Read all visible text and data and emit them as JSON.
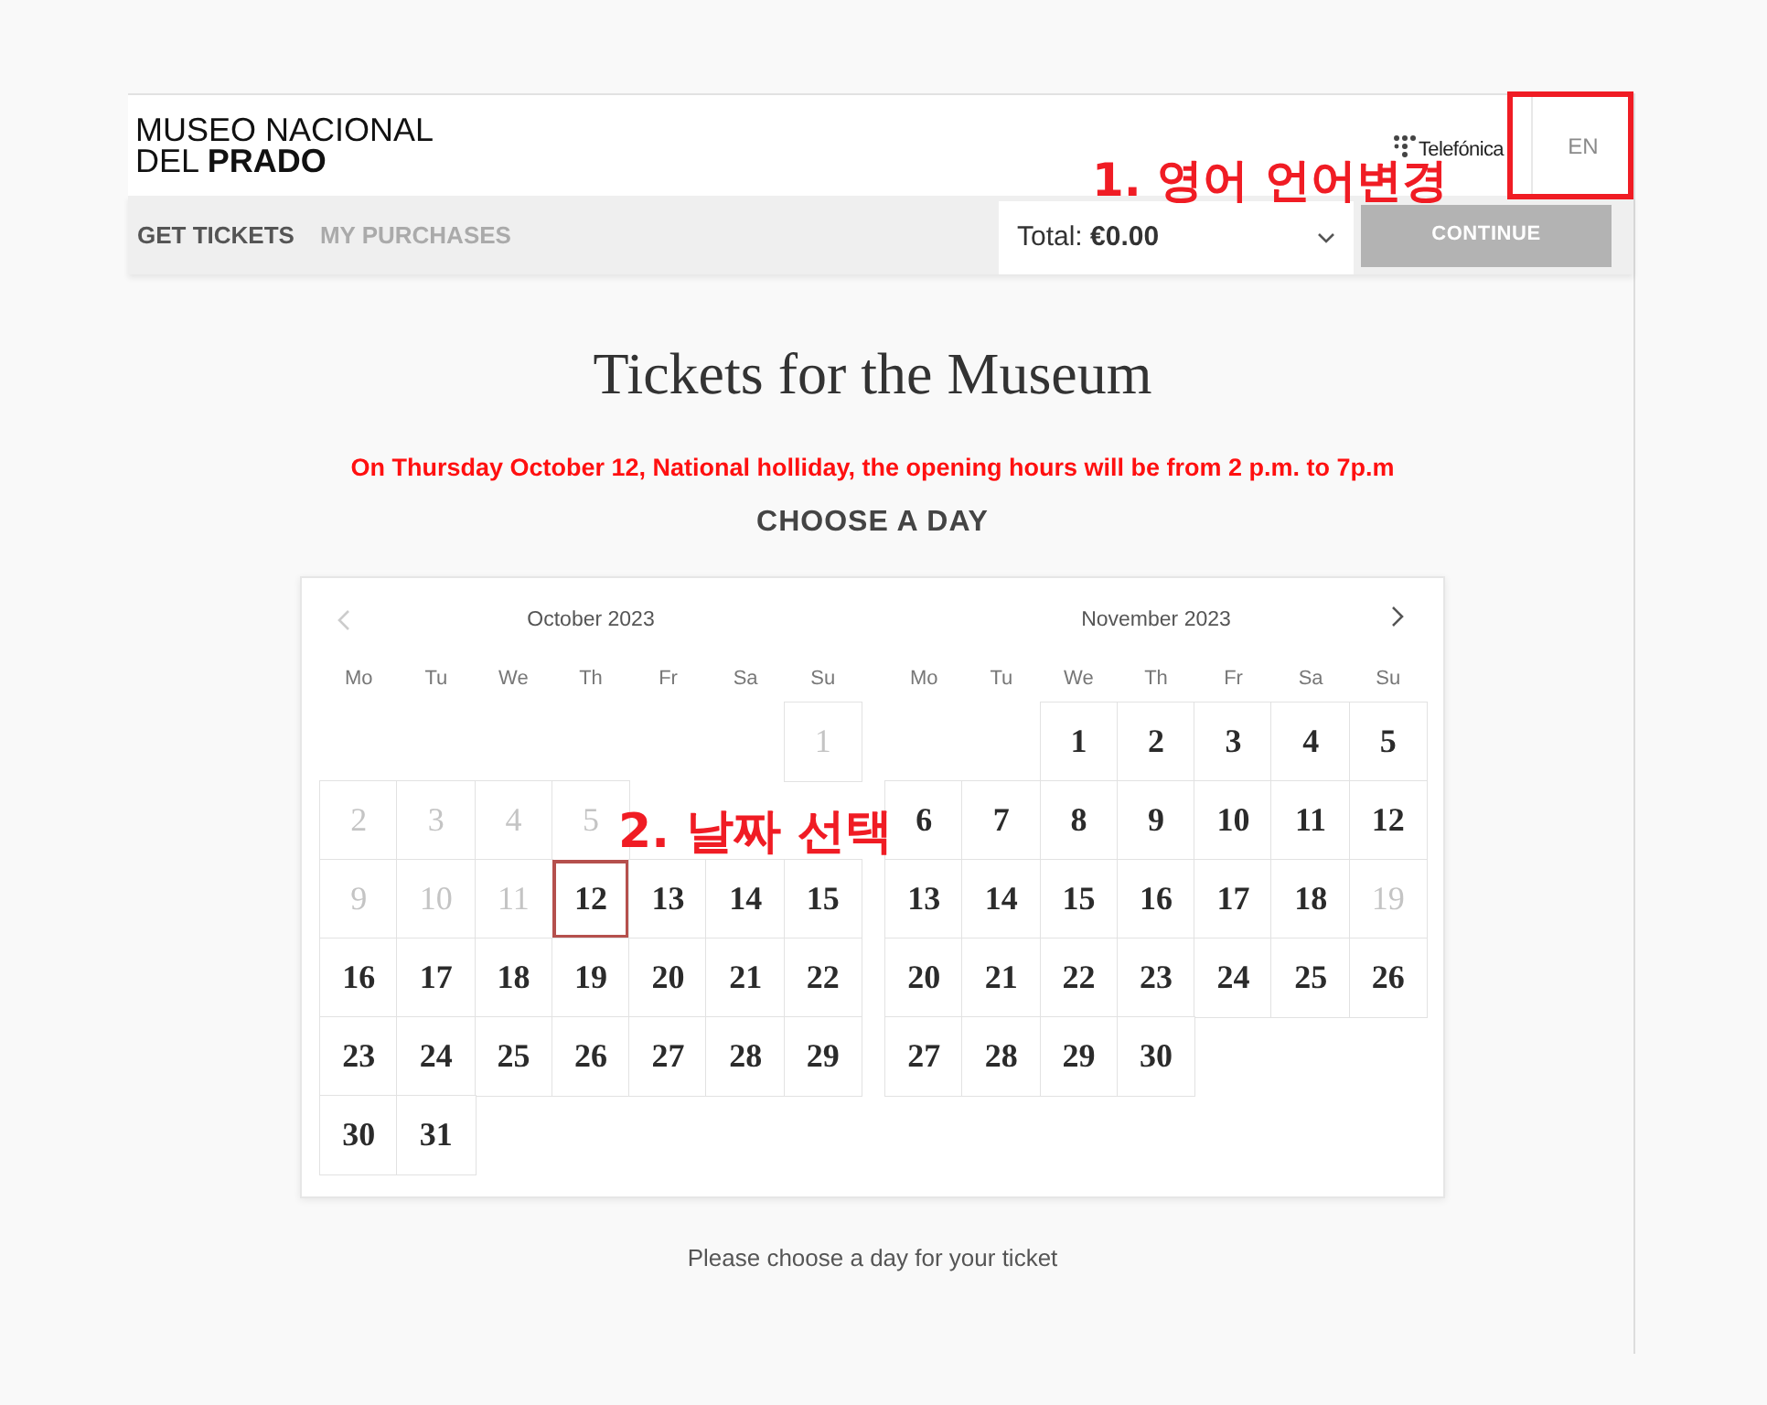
{
  "header": {
    "logo_lines": [
      "MUSEO NACIONAL",
      "DEL **PRADO**"
    ],
    "sponsor": "Telefónica",
    "language": {
      "label": "EN",
      "highlighted": true
    },
    "callout": "1. 영어 언어변경"
  },
  "nav": {
    "tabs": [
      {
        "label": "GET TICKETS",
        "selected": true
      },
      {
        "label": "MY PURCHASES",
        "selected": false
      }
    ],
    "total": "Total: **€0.00**",
    "continue_button": {
      "label": "CONTINUE",
      "disabled": true
    }
  },
  "main": {
    "title": "Tickets for the Museum",
    "notice": "On Thursday October 12, National holliday, the opening hours will be from 2 p.m. to 7p.m",
    "heading": "CHOOSE A DAY"
  },
  "calendar": {
    "callout": "2. 날짜 선택",
    "months": [
      {
        "title": "October 2023",
        "arrow": {
          "kind": "prev",
          "disabled": true
        },
        "weekdays": [
          "Mo",
          "Tu",
          "We",
          "Th",
          "Fr",
          "Sa",
          "Su"
        ],
        "weeks": [
          {
            "kind": "first",
            "days": [
              {
                "kind": "day",
                "label": "1",
                "disabled": true,
                "selected": false
              }
            ]
          },
          {
            "kind": "full",
            "days": [
              {
                "kind": "day",
                "label": "2",
                "disabled": true,
                "selected": false
              },
              {
                "kind": "day",
                "label": "3",
                "disabled": true,
                "selected": false
              },
              {
                "kind": "day",
                "label": "4",
                "disabled": true,
                "selected": false
              },
              {
                "kind": "day",
                "label": "5",
                "disabled": true,
                "selected": false
              },
              {
                "kind": "covered"
              },
              {
                "kind": "covered"
              },
              {
                "kind": "covered"
              }
            ]
          },
          {
            "kind": "full",
            "days": [
              {
                "kind": "day",
                "label": "9",
                "disabled": true,
                "selected": false
              },
              {
                "kind": "day",
                "label": "10",
                "disabled": true,
                "selected": false
              },
              {
                "kind": "day",
                "label": "11",
                "disabled": true,
                "selected": false
              },
              {
                "kind": "day",
                "label": "12",
                "disabled": false,
                "selected": true
              },
              {
                "kind": "day",
                "label": "13",
                "disabled": false,
                "selected": false
              },
              {
                "kind": "day",
                "label": "14",
                "disabled": false,
                "selected": false
              },
              {
                "kind": "day",
                "label": "15",
                "disabled": false,
                "selected": false
              }
            ]
          },
          {
            "kind": "full",
            "days": [
              {
                "kind": "day",
                "label": "16",
                "disabled": false,
                "selected": false
              },
              {
                "kind": "day",
                "label": "17",
                "disabled": false,
                "selected": false
              },
              {
                "kind": "day",
                "label": "18",
                "disabled": false,
                "selected": false
              },
              {
                "kind": "day",
                "label": "19",
                "disabled": false,
                "selected": false
              },
              {
                "kind": "day",
                "label": "20",
                "disabled": false,
                "selected": false
              },
              {
                "kind": "day",
                "label": "21",
                "disabled": false,
                "selected": false
              },
              {
                "kind": "day",
                "label": "22",
                "disabled": false,
                "selected": false
              }
            ]
          },
          {
            "kind": "full",
            "days": [
              {
                "kind": "day",
                "label": "23",
                "disabled": false,
                "selected": false
              },
              {
                "kind": "day",
                "label": "24",
                "disabled": false,
                "selected": false
              },
              {
                "kind": "day",
                "label": "25",
                "disabled": false,
                "selected": false
              },
              {
                "kind": "day",
                "label": "26",
                "disabled": false,
                "selected": false
              },
              {
                "kind": "day",
                "label": "27",
                "disabled": false,
                "selected": false
              },
              {
                "kind": "day",
                "label": "28",
                "disabled": false,
                "selected": false
              },
              {
                "kind": "day",
                "label": "29",
                "disabled": false,
                "selected": false
              }
            ]
          },
          {
            "kind": "last",
            "days": [
              {
                "kind": "day",
                "label": "30",
                "disabled": false,
                "selected": false
              },
              {
                "kind": "day",
                "label": "31",
                "disabled": false,
                "selected": false
              }
            ]
          }
        ]
      },
      {
        "title": "November 2023",
        "arrow": {
          "kind": "next",
          "disabled": false
        },
        "weekdays": [
          "Mo",
          "Tu",
          "We",
          "Th",
          "Fr",
          "Sa",
          "Su"
        ],
        "weeks": [
          {
            "kind": "first",
            "days": [
              {
                "kind": "day",
                "label": "1",
                "disabled": false,
                "selected": false
              },
              {
                "kind": "day",
                "label": "2",
                "disabled": false,
                "selected": false
              },
              {
                "kind": "day",
                "label": "3",
                "disabled": false,
                "selected": false
              },
              {
                "kind": "day",
                "label": "4",
                "disabled": false,
                "selected": false
              },
              {
                "kind": "day",
                "label": "5",
                "disabled": false,
                "selected": false
              }
            ]
          },
          {
            "kind": "full",
            "days": [
              {
                "kind": "day",
                "label": "6",
                "disabled": false,
                "selected": false
              },
              {
                "kind": "day",
                "label": "7",
                "disabled": false,
                "selected": false
              },
              {
                "kind": "day",
                "label": "8",
                "disabled": false,
                "selected": false
              },
              {
                "kind": "day",
                "label": "9",
                "disabled": false,
                "selected": false
              },
              {
                "kind": "day",
                "label": "10",
                "disabled": false,
                "selected": false
              },
              {
                "kind": "day",
                "label": "11",
                "disabled": false,
                "selected": false
              },
              {
                "kind": "day",
                "label": "12",
                "disabled": false,
                "selected": false
              }
            ]
          },
          {
            "kind": "full",
            "days": [
              {
                "kind": "day",
                "label": "13",
                "disabled": false,
                "selected": false
              },
              {
                "kind": "day",
                "label": "14",
                "disabled": false,
                "selected": false
              },
              {
                "kind": "day",
                "label": "15",
                "disabled": false,
                "selected": false
              },
              {
                "kind": "day",
                "label": "16",
                "disabled": false,
                "selected": false
              },
              {
                "kind": "day",
                "label": "17",
                "disabled": false,
                "selected": false
              },
              {
                "kind": "day",
                "label": "18",
                "disabled": false,
                "selected": false
              },
              {
                "kind": "day",
                "label": "19",
                "disabled": true,
                "selected": false
              }
            ]
          },
          {
            "kind": "full",
            "days": [
              {
                "kind": "day",
                "label": "20",
                "disabled": false,
                "selected": false
              },
              {
                "kind": "day",
                "label": "21",
                "disabled": false,
                "selected": false
              },
              {
                "kind": "day",
                "label": "22",
                "disabled": false,
                "selected": false
              },
              {
                "kind": "day",
                "label": "23",
                "disabled": false,
                "selected": false
              },
              {
                "kind": "day",
                "label": "24",
                "disabled": false,
                "selected": false
              },
              {
                "kind": "day",
                "label": "25",
                "disabled": false,
                "selected": false
              },
              {
                "kind": "day",
                "label": "26",
                "disabled": false,
                "selected": false
              }
            ]
          },
          {
            "kind": "last",
            "days": [
              {
                "kind": "day",
                "label": "27",
                "disabled": false,
                "selected": false
              },
              {
                "kind": "day",
                "label": "28",
                "disabled": false,
                "selected": false
              },
              {
                "kind": "day",
                "label": "29",
                "disabled": false,
                "selected": false
              },
              {
                "kind": "day",
                "label": "30",
                "disabled": false,
                "selected": false
              }
            ]
          }
        ]
      }
    ]
  },
  "footer_hint": "Please choose a day for your ticket"
}
